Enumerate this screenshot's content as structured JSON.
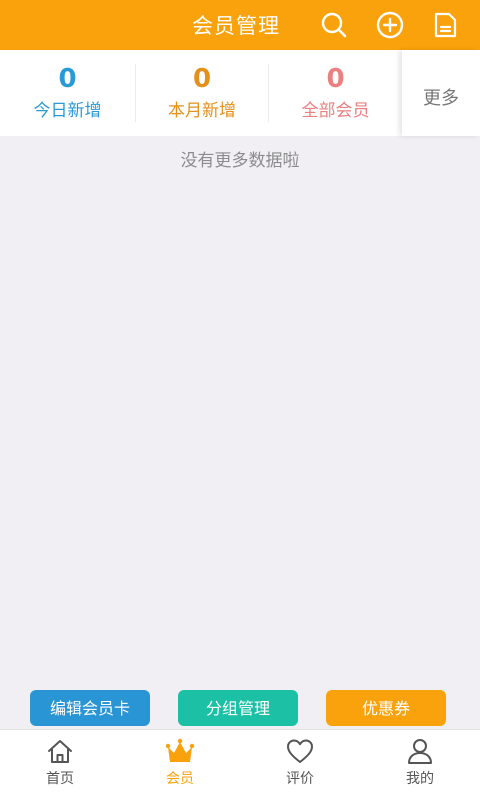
{
  "header": {
    "title": "会员管理",
    "icons": [
      "search-icon",
      "add-circle-icon",
      "document-icon"
    ],
    "color": "#f9a20c"
  },
  "stats": [
    {
      "value": "0",
      "label": "今日新增",
      "color": "#2a9ad6"
    },
    {
      "value": "0",
      "label": "本月新增",
      "color": "#e4901a"
    },
    {
      "value": "0",
      "label": "全部会员",
      "color": "#ec7f7f"
    }
  ],
  "more_label": "更多",
  "empty_message": "没有更多数据啦",
  "actions": [
    {
      "label": "编辑会员卡",
      "color": "#2a95d5"
    },
    {
      "label": "分组管理",
      "color": "#1cc0a5"
    },
    {
      "label": "优惠券",
      "color": "#f9a20c"
    }
  ],
  "nav": [
    {
      "label": "首页",
      "icon": "home-icon",
      "active": false
    },
    {
      "label": "会员",
      "icon": "crown-icon",
      "active": true
    },
    {
      "label": "评价",
      "icon": "heart-icon",
      "active": false
    },
    {
      "label": "我的",
      "icon": "person-icon",
      "active": false
    }
  ],
  "colors": {
    "nav_active": "#f9a20c",
    "nav_inactive": "#555555"
  }
}
